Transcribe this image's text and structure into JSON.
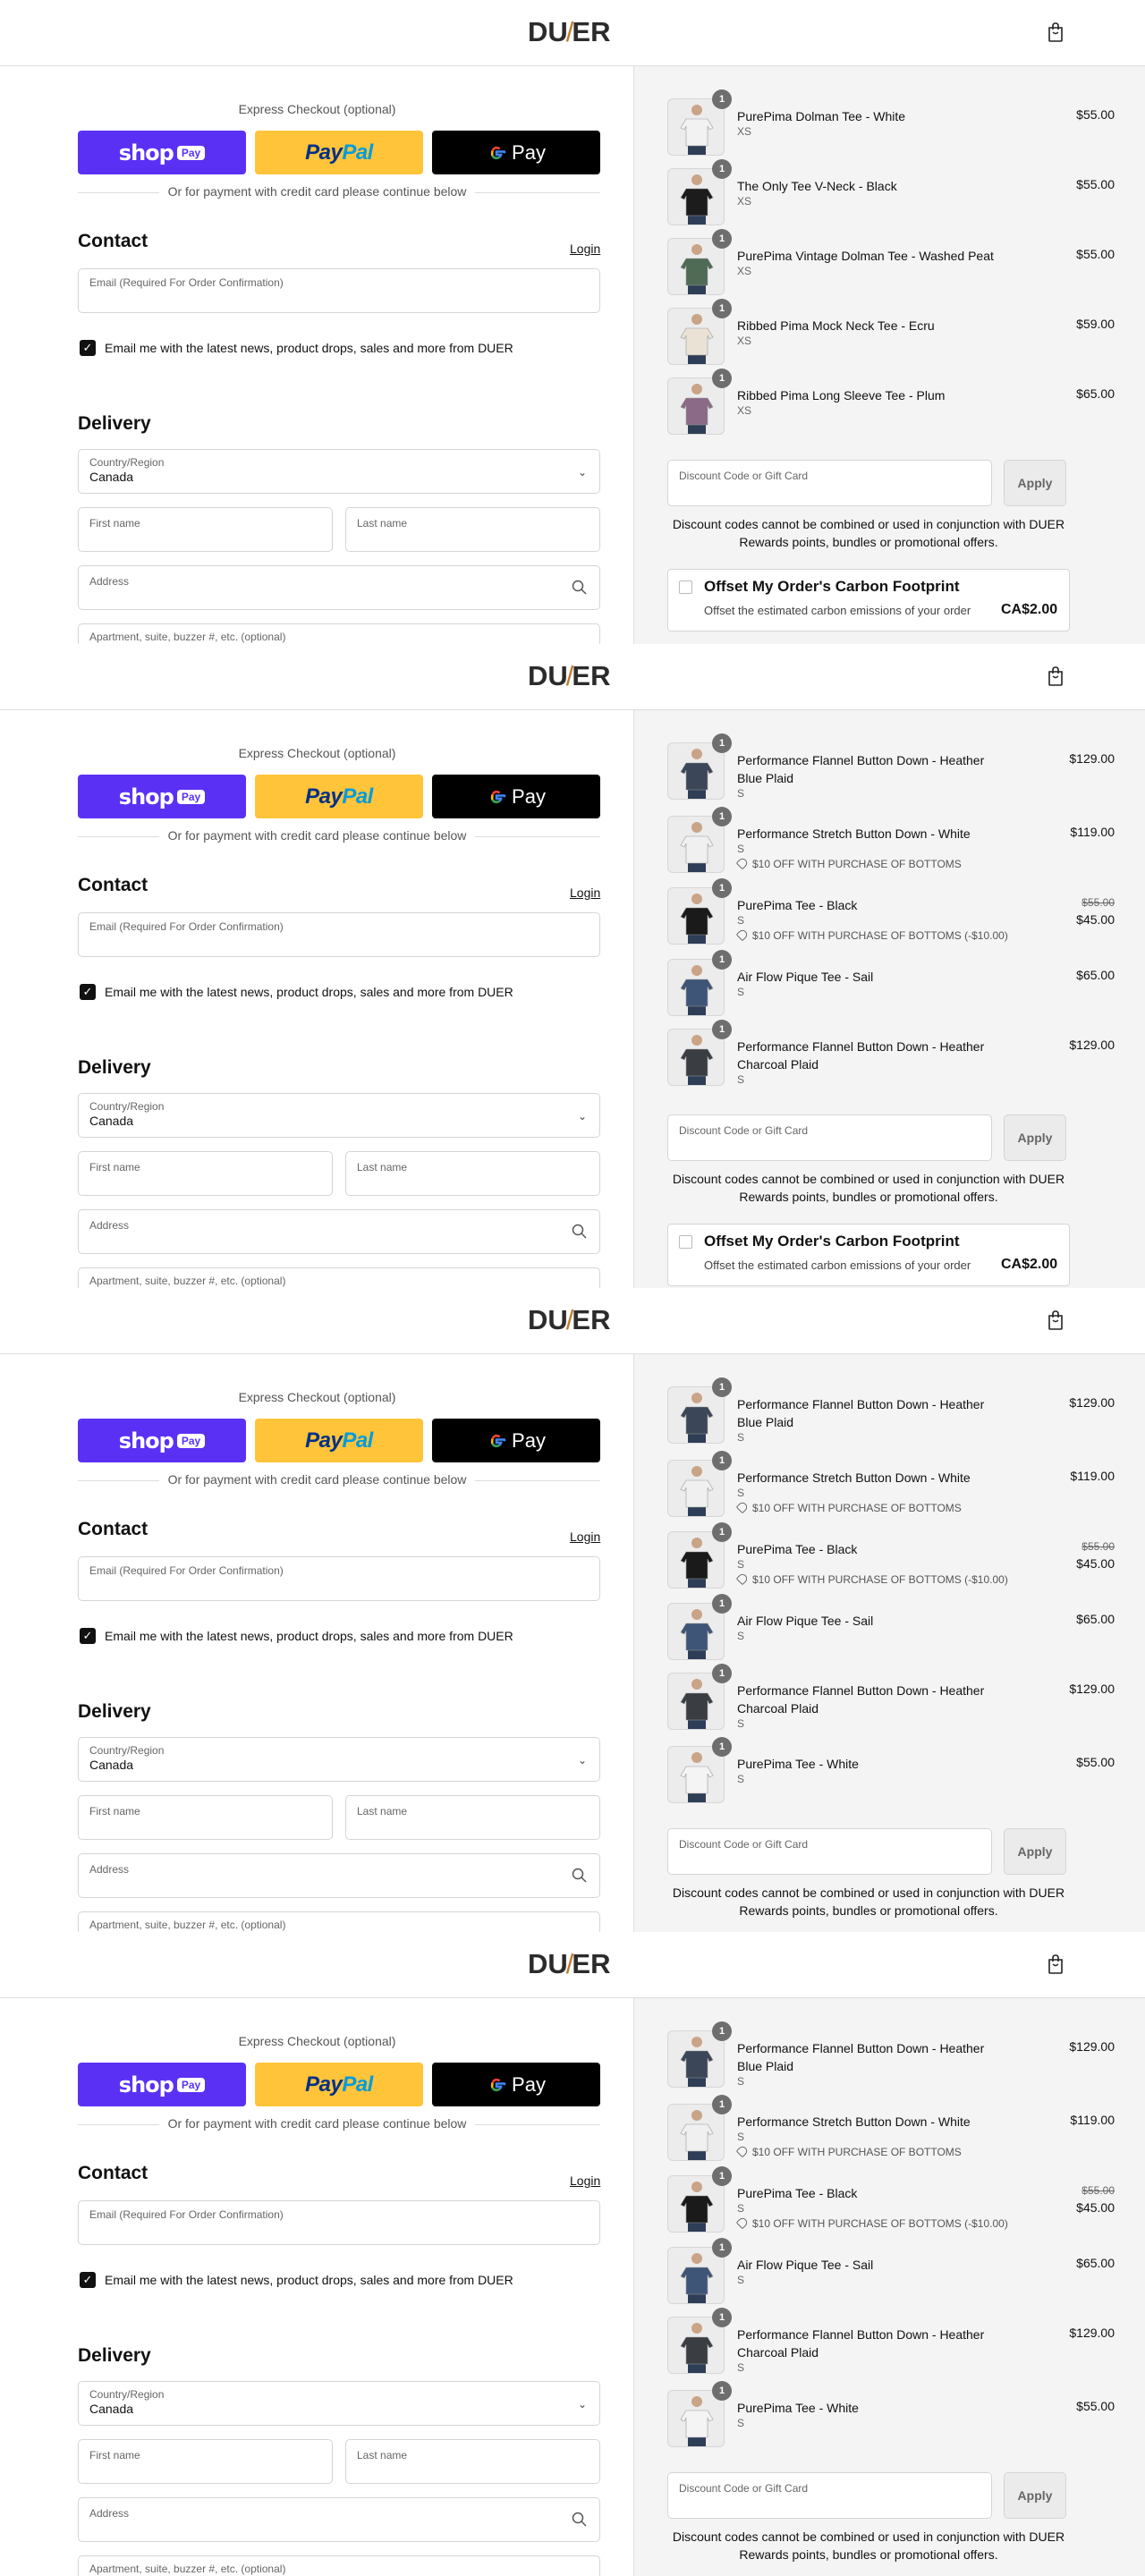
{
  "header": {
    "logo_left": "DU",
    "logo_slash": "/",
    "logo_right": "ER",
    "cart_icon": "shopping-bag-icon"
  },
  "express": {
    "title": "Express Checkout (optional)",
    "shop_label": "shop",
    "shop_pill": "Pay",
    "paypal_pay": "Pay",
    "paypal_pal": "Pal",
    "gpay_g": "G",
    "gpay_label": "Pay",
    "divider_text": "Or for payment with credit card please continue below"
  },
  "contact": {
    "heading": "Contact",
    "login_link": "Login",
    "email_placeholder": "Email (Required For Order Confirmation)",
    "newsletter_checked": true,
    "newsletter_label": "Email me with the latest news, product drops, sales and more from DUER"
  },
  "delivery": {
    "heading": "Delivery",
    "country_label": "Country/Region",
    "country_value": "Canada",
    "first_name_placeholder": "First name",
    "last_name_placeholder": "Last name",
    "address_placeholder": "Address",
    "apartment_placeholder": "Apartment, suite, buzzer #, etc. (optional)"
  },
  "discount": {
    "placeholder": "Discount Code or Gift Card",
    "apply_label": "Apply",
    "note_line1": "Discount codes cannot be combined or used in conjunction with DUER",
    "note_line2": "Rewards points, bundles or promotional offers."
  },
  "offset": {
    "title": "Offset My Order's Carbon Footprint",
    "desc": "Offset the estimated carbon emissions of your order",
    "price": "CA$2.00"
  },
  "frames": [
    {
      "items": [
        {
          "qty": "1",
          "name": "PurePima Dolman Tee - White",
          "variant": "XS",
          "price": "$55.00",
          "color": "#f2f2f2"
        },
        {
          "qty": "1",
          "name": "The Only Tee V-Neck - Black",
          "variant": "XS",
          "price": "$55.00",
          "color": "#1c1c1c"
        },
        {
          "qty": "1",
          "name": "PurePima Vintage Dolman Tee - Washed Peat",
          "variant": "XS",
          "price": "$55.00",
          "color": "#4f6a55"
        },
        {
          "qty": "1",
          "name": "Ribbed Pima Mock Neck Tee - Ecru",
          "variant": "XS",
          "price": "$59.00",
          "color": "#e9e2d5"
        },
        {
          "qty": "1",
          "name": "Ribbed Pima Long Sleeve Tee - Plum",
          "variant": "XS",
          "price": "$65.00",
          "color": "#8a6a86"
        }
      ]
    },
    {
      "items": [
        {
          "qty": "1",
          "name": "Performance Flannel Button Down - Heather Blue Plaid",
          "variant": "S",
          "price": "$129.00",
          "color": "#3b4658"
        },
        {
          "qty": "1",
          "name": "Performance Stretch Button Down - White",
          "variant": "S",
          "price": "$119.00",
          "discount": "$10 OFF WITH PURCHASE OF BOTTOMS",
          "color": "#f0f0f0"
        },
        {
          "qty": "1",
          "name": "PurePima Tee - Black",
          "variant": "S",
          "old_price": "$55.00",
          "price": "$45.00",
          "discount": "$10 OFF WITH PURCHASE OF BOTTOMS (-$10.00)",
          "color": "#1a1a1a"
        },
        {
          "qty": "1",
          "name": "Air Flow Pique Tee - Sail",
          "variant": "S",
          "price": "$65.00",
          "color": "#3e5577"
        },
        {
          "qty": "1",
          "name": "Performance Flannel Button Down - Heather Charcoal Plaid",
          "variant": "S",
          "price": "$129.00",
          "color": "#3a3d42"
        }
      ]
    },
    {
      "items": [
        {
          "qty": "1",
          "name": "Performance Flannel Button Down - Heather Blue Plaid",
          "variant": "S",
          "price": "$129.00",
          "color": "#3b4658"
        },
        {
          "qty": "1",
          "name": "Performance Stretch Button Down - White",
          "variant": "S",
          "price": "$119.00",
          "discount": "$10 OFF WITH PURCHASE OF BOTTOMS",
          "color": "#f0f0f0"
        },
        {
          "qty": "1",
          "name": "PurePima Tee - Black",
          "variant": "S",
          "old_price": "$55.00",
          "price": "$45.00",
          "discount": "$10 OFF WITH PURCHASE OF BOTTOMS (-$10.00)",
          "color": "#1a1a1a"
        },
        {
          "qty": "1",
          "name": "Air Flow Pique Tee - Sail",
          "variant": "S",
          "price": "$65.00",
          "color": "#3e5577"
        },
        {
          "qty": "1",
          "name": "Performance Flannel Button Down - Heather Charcoal Plaid",
          "variant": "S",
          "price": "$129.00",
          "color": "#3a3d42"
        },
        {
          "qty": "1",
          "name": "PurePima Tee - White",
          "variant": "S",
          "price": "$55.00",
          "color": "#f4f4f4"
        }
      ]
    },
    {
      "items": [
        {
          "qty": "1",
          "name": "Performance Flannel Button Down - Heather Blue Plaid",
          "variant": "S",
          "price": "$129.00",
          "color": "#3b4658"
        },
        {
          "qty": "1",
          "name": "Performance Stretch Button Down - White",
          "variant": "S",
          "price": "$119.00",
          "discount": "$10 OFF WITH PURCHASE OF BOTTOMS",
          "color": "#f0f0f0"
        },
        {
          "qty": "1",
          "name": "PurePima Tee - Black",
          "variant": "S",
          "old_price": "$55.00",
          "price": "$45.00",
          "discount": "$10 OFF WITH PURCHASE OF BOTTOMS (-$10.00)",
          "color": "#1a1a1a"
        },
        {
          "qty": "1",
          "name": "Air Flow Pique Tee - Sail",
          "variant": "S",
          "price": "$65.00",
          "color": "#3e5577"
        },
        {
          "qty": "1",
          "name": "Performance Flannel Button Down - Heather Charcoal Plaid",
          "variant": "S",
          "price": "$129.00",
          "color": "#3a3d42"
        },
        {
          "qty": "1",
          "name": "PurePima Tee - White",
          "variant": "S",
          "price": "$55.00",
          "color": "#f4f4f4"
        }
      ]
    }
  ]
}
